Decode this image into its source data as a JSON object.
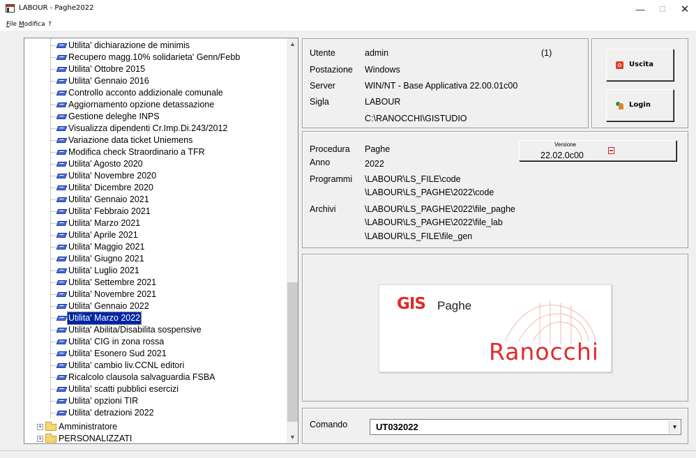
{
  "window": {
    "title": "LABOUR - Paghe2022",
    "minimize": "—",
    "maximize": "☐",
    "close": "✕"
  },
  "menubar": [
    {
      "label": "File",
      "accel": "F"
    },
    {
      "label": "Modifica",
      "accel": "M"
    },
    {
      "label": "?"
    }
  ],
  "tree": {
    "items": [
      "Utilita' dichiarazione de minimis",
      "Recupero magg.10% solidarieta' Genn/Febb",
      "Utilita' Ottobre 2015",
      "Utilita' Gennaio 2016",
      "Controllo acconto addizionale comunale",
      "Aggiornamento opzione detassazione",
      "Gestione deleghe INPS",
      "Visualizza dipendenti Cr.Imp.Di.243/2012",
      "Variazione data ticket Uniemens",
      "Modifica check Straordinario a TFR",
      "Utilita' Agosto 2020",
      "Utilita' Novembre 2020",
      "Utilita' Dicembre 2020",
      "Utilita' Gennaio  2021",
      "Utilita' Febbraio 2021",
      "Utilita' Marzo 2021",
      "Utilita' Aprile 2021",
      "Utilita' Maggio 2021",
      "Utilita' Giugno 2021",
      "Utilita' Luglio 2021",
      "Utilita' Settembre 2021",
      "Utilita' Novembre 2021",
      "Utilita' Gennaio 2022",
      "Utilita' Marzo 2022",
      "Utilita' Abilita/Disabilita sospensive",
      "Utilita' CIG in zona rossa",
      "Utilita' Esonero Sud 2021",
      "Utilita' cambio liv.CCNL editori",
      "Ricalcolo clausola salvaguardia FSBA",
      "Utilita' scatti pubblici esercizi",
      "Utilita' opzioni TIR",
      "Utilita' detrazioni 2022"
    ],
    "selected": "Utilita' Marzo 2022",
    "folders": [
      "Amministratore",
      "PERSONALIZZATI"
    ],
    "scroll_up": "▲",
    "scroll_down": "▼"
  },
  "info": {
    "utente_label": "Utente",
    "utente_value": "admin",
    "utente_count": "(1)",
    "postazione_label": "Postazione",
    "postazione_value": "Windows",
    "server_label": "Server",
    "server_value": "WIN/NT - Base Applicativa 22.00.01c00",
    "sigla_label": "Sigla",
    "sigla_value": "LABOUR",
    "path_value": "C:\\RANOCCHI\\GISTUDIO"
  },
  "buttons": {
    "exit": "Uscita",
    "login": "Login"
  },
  "procedure": {
    "procedura_label": "Procedura",
    "procedura_value": "Paghe",
    "anno_label": "Anno",
    "anno_value": "2022",
    "programmi_label": "Programmi",
    "programmi_values": [
      "\\LABOUR\\LS_FILE\\code",
      "\\LABOUR\\LS_PAGHE\\2022\\code"
    ],
    "archivi_label": "Archivi",
    "archivi_values": [
      "\\LABOUR\\LS_PAGHE\\2022\\file_paghe",
      "\\LABOUR\\LS_PAGHE\\2022\\file_lab",
      "\\LABOUR\\LS_FILE\\file_gen"
    ],
    "versione_label": "Versione",
    "versione_value": "22.02.0c00"
  },
  "logo": {
    "gis": "GIS",
    "paghe": "Paghe",
    "ranocchi": "Ranocchi",
    "accent_color": "#e02a26"
  },
  "command": {
    "label": "Comando",
    "value": "UT032022",
    "dropdown_icon": "▼"
  }
}
